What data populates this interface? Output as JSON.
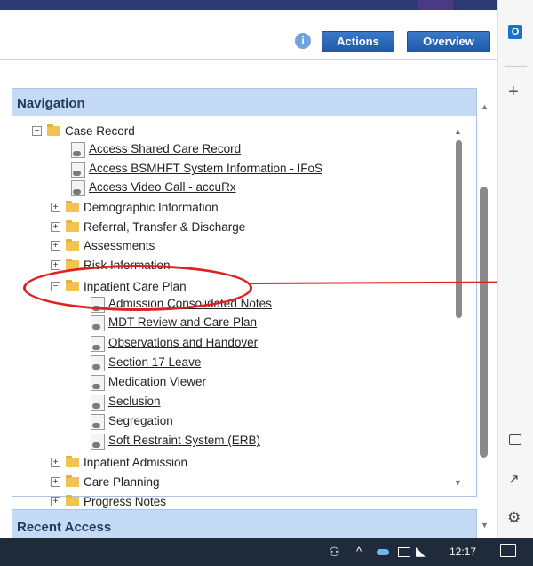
{
  "toolbar": {
    "actions_label": "Actions",
    "overview_label": "Overview",
    "info_icon": "info-icon"
  },
  "navigation": {
    "title": "Navigation",
    "tree": [
      {
        "label": "Case Record",
        "type": "folder",
        "expander": "−"
      },
      {
        "label": "Access Shared Care Record",
        "type": "link"
      },
      {
        "label": "Access BSMHFT System Information - IFoS",
        "type": "link"
      },
      {
        "label": "Access Video Call - accuRx",
        "type": "link"
      },
      {
        "label": "Demographic Information",
        "type": "folder",
        "expander": "+"
      },
      {
        "label": "Referral, Transfer & Discharge",
        "type": "folder",
        "expander": "+"
      },
      {
        "label": "Assessments",
        "type": "folder",
        "expander": "+"
      },
      {
        "label": "Risk Information",
        "type": "folder",
        "expander": "+"
      },
      {
        "label": "Inpatient Care Plan",
        "type": "folder",
        "expander": "−"
      },
      {
        "label": "Admission Consolidated Notes",
        "type": "link"
      },
      {
        "label": "MDT Review and Care Plan",
        "type": "link"
      },
      {
        "label": "Observations and Handover",
        "type": "link"
      },
      {
        "label": "Section 17 Leave",
        "type": "link"
      },
      {
        "label": "Medication Viewer",
        "type": "link"
      },
      {
        "label": "Seclusion",
        "type": "link"
      },
      {
        "label": "Segregation",
        "type": "link"
      },
      {
        "label": "Soft Restraint System (ERB)",
        "type": "link"
      },
      {
        "label": "Inpatient Admission",
        "type": "folder",
        "expander": "+"
      },
      {
        "label": "Care Planning",
        "type": "folder",
        "expander": "+"
      },
      {
        "label": "Progress Notes",
        "type": "folder",
        "expander": "+"
      }
    ]
  },
  "recent": {
    "title": "Recent Access"
  },
  "taskbar": {
    "time": "12:17"
  },
  "annotation": {
    "color": "#e02020"
  }
}
